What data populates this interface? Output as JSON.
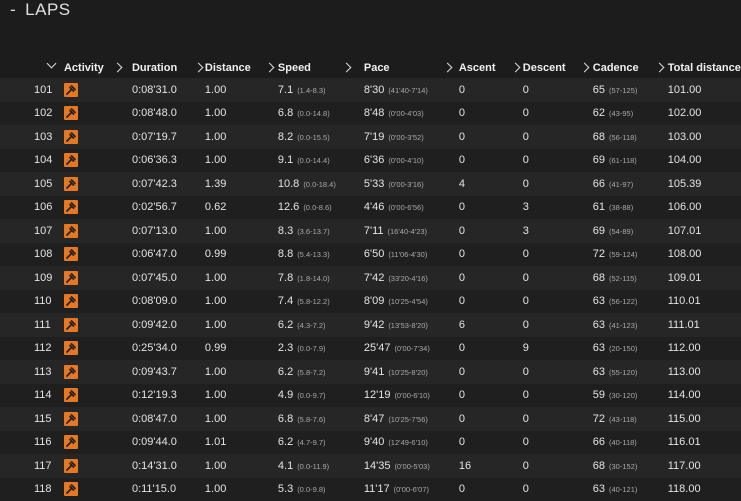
{
  "section": {
    "toggle": "-",
    "title": "LAPS"
  },
  "columns": [
    "Activity",
    "Duration",
    "Distance",
    "Speed",
    "Pace",
    "Ascent",
    "Descent",
    "Cadence",
    "Total distance"
  ],
  "activity_icon": "run-icon",
  "accent_color": "#e87722",
  "rows": [
    {
      "lap": "101",
      "duration": "0:08'31.0",
      "distance": "1.00",
      "speed": "7.1",
      "speed_range": "(1.4-8.3)",
      "pace": "8'30",
      "pace_range": "(41'40-7'14)",
      "ascent": "0",
      "descent": "0",
      "cadence": "65",
      "cadence_range": "(57-125)",
      "total": "101.00"
    },
    {
      "lap": "102",
      "duration": "0:08'48.0",
      "distance": "1.00",
      "speed": "6.8",
      "speed_range": "(0.0-14.8)",
      "pace": "8'48",
      "pace_range": "(0'00-4'03)",
      "ascent": "0",
      "descent": "0",
      "cadence": "62",
      "cadence_range": "(43-95)",
      "total": "102.00"
    },
    {
      "lap": "103",
      "duration": "0:07'19.7",
      "distance": "1.00",
      "speed": "8.2",
      "speed_range": "(0.0-15.5)",
      "pace": "7'19",
      "pace_range": "(0'00-3'52)",
      "ascent": "0",
      "descent": "0",
      "cadence": "68",
      "cadence_range": "(56-118)",
      "total": "103.00"
    },
    {
      "lap": "104",
      "duration": "0:06'36.3",
      "distance": "1.00",
      "speed": "9.1",
      "speed_range": "(0.0-14.4)",
      "pace": "6'36",
      "pace_range": "(0'00-4'10)",
      "ascent": "0",
      "descent": "0",
      "cadence": "69",
      "cadence_range": "(61-118)",
      "total": "104.00"
    },
    {
      "lap": "105",
      "duration": "0:07'42.3",
      "distance": "1.39",
      "speed": "10.8",
      "speed_range": "(0.0-18.4)",
      "pace": "5'33",
      "pace_range": "(0'00-3'16)",
      "ascent": "4",
      "descent": "0",
      "cadence": "66",
      "cadence_range": "(41-97)",
      "total": "105.39"
    },
    {
      "lap": "106",
      "duration": "0:02'56.7",
      "distance": "0.62",
      "speed": "12.6",
      "speed_range": "(0.0-8.6)",
      "pace": "4'46",
      "pace_range": "(0'00-6'56)",
      "ascent": "0",
      "descent": "3",
      "cadence": "61",
      "cadence_range": "(38-88)",
      "total": "106.00"
    },
    {
      "lap": "107",
      "duration": "0:07'13.0",
      "distance": "1.00",
      "speed": "8.3",
      "speed_range": "(3.6-13.7)",
      "pace": "7'11",
      "pace_range": "(16'40-4'23)",
      "ascent": "0",
      "descent": "3",
      "cadence": "69",
      "cadence_range": "(54-89)",
      "total": "107.01"
    },
    {
      "lap": "108",
      "duration": "0:06'47.0",
      "distance": "0.99",
      "speed": "8.8",
      "speed_range": "(5.4-13.3)",
      "pace": "6'50",
      "pace_range": "(11'06-4'30)",
      "ascent": "0",
      "descent": "0",
      "cadence": "72",
      "cadence_range": "(59-124)",
      "total": "108.00"
    },
    {
      "lap": "109",
      "duration": "0:07'45.0",
      "distance": "1.00",
      "speed": "7.8",
      "speed_range": "(1.8-14.0)",
      "pace": "7'42",
      "pace_range": "(33'20-4'16)",
      "ascent": "0",
      "descent": "0",
      "cadence": "68",
      "cadence_range": "(52-115)",
      "total": "109.01"
    },
    {
      "lap": "110",
      "duration": "0:08'09.0",
      "distance": "1.00",
      "speed": "7.4",
      "speed_range": "(5.8-12.2)",
      "pace": "8'09",
      "pace_range": "(10'25-4'54)",
      "ascent": "0",
      "descent": "0",
      "cadence": "63",
      "cadence_range": "(56-122)",
      "total": "110.01"
    },
    {
      "lap": "111",
      "duration": "0:09'42.0",
      "distance": "1.00",
      "speed": "6.2",
      "speed_range": "(4.3-7.2)",
      "pace": "9'42",
      "pace_range": "(13'53-8'20)",
      "ascent": "6",
      "descent": "0",
      "cadence": "63",
      "cadence_range": "(41-123)",
      "total": "111.01"
    },
    {
      "lap": "112",
      "duration": "0:25'34.0",
      "distance": "0.99",
      "speed": "2.3",
      "speed_range": "(0.0-7.9)",
      "pace": "25'47",
      "pace_range": "(0'00-7'34)",
      "ascent": "0",
      "descent": "9",
      "cadence": "63",
      "cadence_range": "(20-150)",
      "total": "112.00"
    },
    {
      "lap": "113",
      "duration": "0:09'43.7",
      "distance": "1.00",
      "speed": "6.2",
      "speed_range": "(5.8-7.2)",
      "pace": "9'41",
      "pace_range": "(10'25-8'20)",
      "ascent": "0",
      "descent": "0",
      "cadence": "63",
      "cadence_range": "(55-120)",
      "total": "113.00"
    },
    {
      "lap": "114",
      "duration": "0:12'19.3",
      "distance": "1.00",
      "speed": "4.9",
      "speed_range": "(0.0-9.7)",
      "pace": "12'19",
      "pace_range": "(0'00-6'10)",
      "ascent": "0",
      "descent": "0",
      "cadence": "59",
      "cadence_range": "(30-120)",
      "total": "114.00"
    },
    {
      "lap": "115",
      "duration": "0:08'47.0",
      "distance": "1.00",
      "speed": "6.8",
      "speed_range": "(5.8-7.6)",
      "pace": "8'47",
      "pace_range": "(10'25-7'56)",
      "ascent": "0",
      "descent": "0",
      "cadence": "72",
      "cadence_range": "(43-118)",
      "total": "115.00"
    },
    {
      "lap": "116",
      "duration": "0:09'44.0",
      "distance": "1.01",
      "speed": "6.2",
      "speed_range": "(4.7-9.7)",
      "pace": "9'40",
      "pace_range": "(12'49-6'10)",
      "ascent": "0",
      "descent": "0",
      "cadence": "66",
      "cadence_range": "(40-118)",
      "total": "116.01"
    },
    {
      "lap": "117",
      "duration": "0:14'31.0",
      "distance": "1.00",
      "speed": "4.1",
      "speed_range": "(0.0-11.9)",
      "pace": "14'35",
      "pace_range": "(0'00-5'03)",
      "ascent": "16",
      "descent": "0",
      "cadence": "68",
      "cadence_range": "(30-152)",
      "total": "117.00"
    },
    {
      "lap": "118",
      "duration": "0:11'15.0",
      "distance": "1.00",
      "speed": "5.3",
      "speed_range": "(0.0-9.8)",
      "pace": "11'17",
      "pace_range": "(0'00-6'07)",
      "ascent": "0",
      "descent": "0",
      "cadence": "63",
      "cadence_range": "(40-121)",
      "total": "118.00"
    }
  ]
}
